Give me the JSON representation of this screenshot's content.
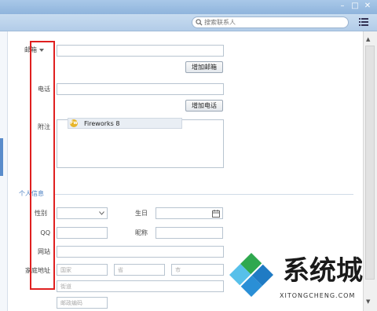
{
  "toolbar": {
    "search_placeholder": "搜索联系人",
    "window_min": "–",
    "window_max": "□",
    "window_close": "✕"
  },
  "form": {
    "email_label": "邮箱",
    "add_email_button": "增加邮箱",
    "phone_label": "电话",
    "add_phone_button": "增加电话",
    "notes_label": "附注",
    "notes_item": "Fireworks 8",
    "section_title": "个人信息",
    "gender_label": "性别",
    "birthday_label": "生日",
    "qq_label": "QQ",
    "nickname_label": "昵称",
    "website_label": "网站",
    "home_address_label": "家庭地址",
    "country_placeholder": "国家",
    "province_placeholder": "省",
    "city_placeholder": "市",
    "street_placeholder": "街道",
    "postal_placeholder": "邮政编码"
  },
  "watermark": {
    "text": "系统城",
    "sub": "XITONGCHENG.COM"
  },
  "colors": {
    "highlight": "#e02020",
    "section": "#4a7fc1",
    "logo_green": "#2fa84f",
    "logo_blue": "#2a8fd6"
  }
}
